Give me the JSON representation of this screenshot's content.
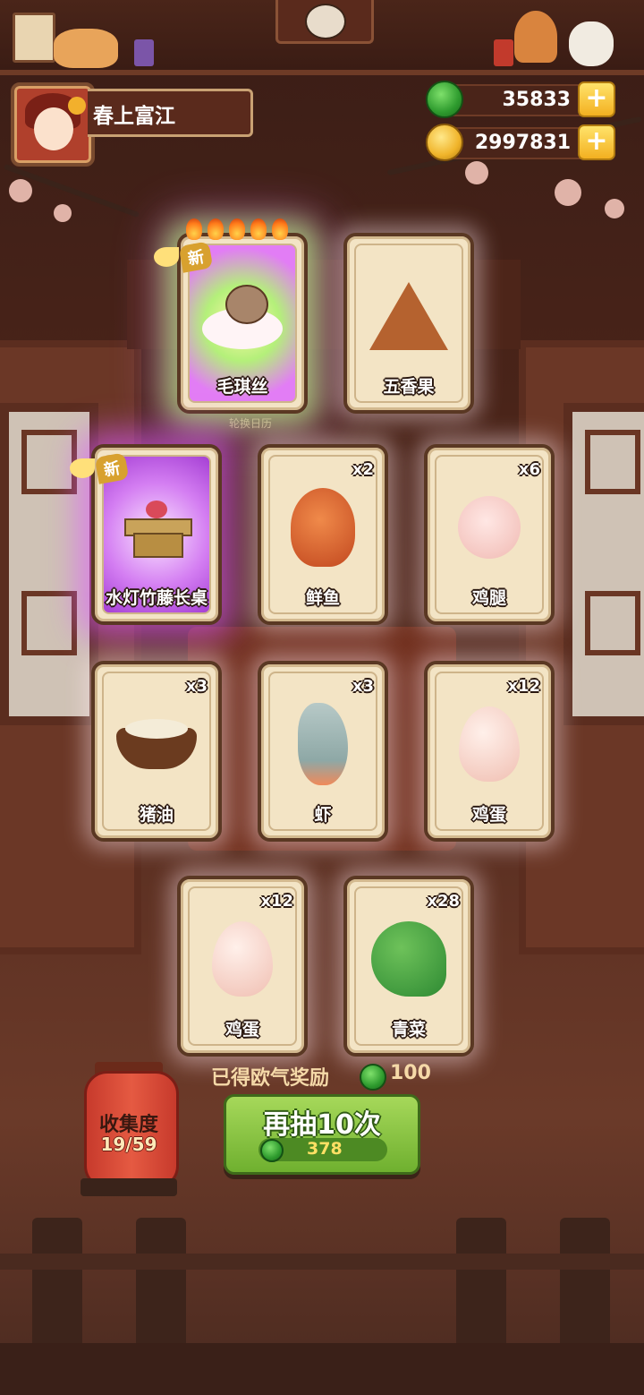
{
  "player": {
    "name": "春上富江"
  },
  "currency": {
    "jade": "35833",
    "coins": "2997831",
    "plus": "+"
  },
  "background": {
    "banner_text": "轮换日历"
  },
  "cards": [
    {
      "name": "毛琪丝",
      "qty": "",
      "new": true,
      "new_label": "新",
      "flames": 5,
      "glow": "rainbow",
      "icon": "hermit-crab-cat-icon"
    },
    {
      "name": "五香果",
      "qty": "",
      "new": false,
      "glow": "white",
      "icon": "spiced-triangle-fruit-icon"
    },
    {
      "name": "水灯竹藤长桌",
      "qty": "",
      "new": true,
      "new_label": "新",
      "glow": "purple",
      "icon": "bamboo-table-icon"
    },
    {
      "name": "鲜鱼",
      "qty": "x2",
      "new": false,
      "glow": "white",
      "icon": "fish-icon"
    },
    {
      "name": "鸡腿",
      "qty": "x6",
      "new": false,
      "glow": "white",
      "icon": "chicken-leg-icon"
    },
    {
      "name": "猪油",
      "qty": "x3",
      "new": false,
      "glow": "white",
      "icon": "lard-bowl-icon"
    },
    {
      "name": "虾",
      "qty": "x3",
      "new": false,
      "glow": "white",
      "icon": "shrimp-icon"
    },
    {
      "name": "鸡蛋",
      "qty": "x12",
      "new": false,
      "glow": "white",
      "icon": "egg-icon"
    },
    {
      "name": "鸡蛋",
      "qty": "x12",
      "new": false,
      "glow": "white",
      "icon": "egg-icon"
    },
    {
      "name": "青菜",
      "qty": "x28",
      "new": false,
      "glow": "white",
      "icon": "bok-choy-icon"
    }
  ],
  "bottom": {
    "reward_label": "已得欧气奖励",
    "reward_value": "100",
    "draw_button_label": "再抽10次",
    "draw_cost": "378",
    "collection_label": "收集度",
    "collection_value": "19/59"
  },
  "colors": {
    "draw_button": "#8cc443",
    "lantern": "#d94a36",
    "card_bg": "#f3e4c5",
    "jade": "#2e9b2e",
    "coin": "#f0b42a"
  }
}
